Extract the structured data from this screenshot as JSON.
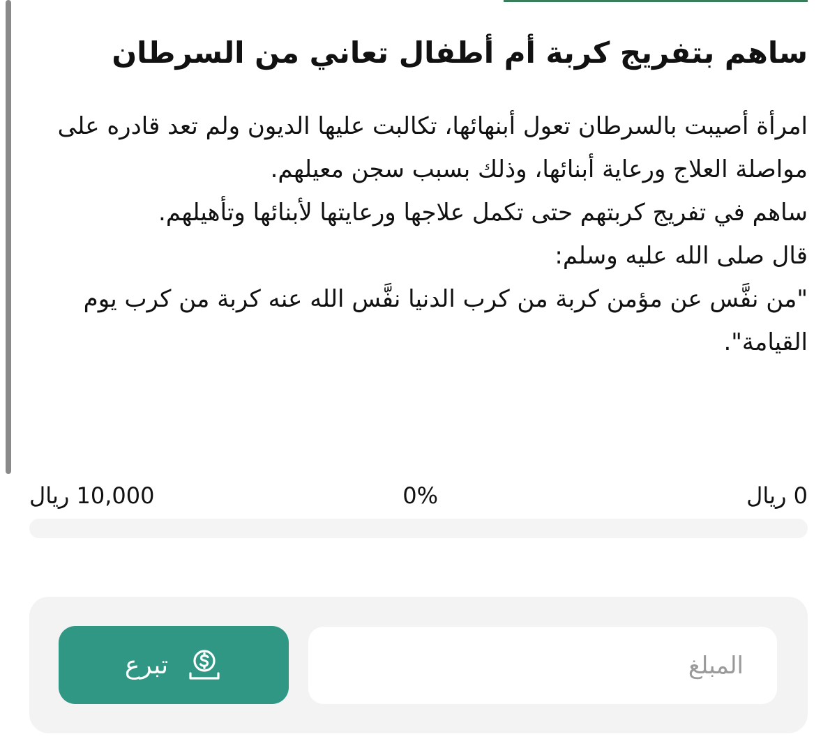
{
  "campaign": {
    "title": "ساهم بتفريج كربة أم أطفال تعاني من السرطان",
    "paragraphs": [
      "امرأة أصيبت بالسرطان تعول أبنهائها، تكالبت عليها الديون ولم تعد قادره على مواصلة العلاج ورعاية أبنائها، وذلك بسبب سجن معيلهم.",
      "ساهم في تفريج كربتهم حتى تكمل علاجها ورعايتها لأبنائها وتأهيلهم.",
      "قال صلى الله عليه وسلم:",
      "\"من نفَّس عن مؤمن كربة من كرب الدنيا نفَّس الله عنه كربة من كرب يوم القيامة\"."
    ]
  },
  "progress": {
    "min_label": "0 ريال",
    "percent_label": "0%",
    "max_label": "10,000 ريال",
    "fraction": 0,
    "fill_color": "#2f9784",
    "track_color": "#f4f4f4"
  },
  "donate": {
    "amount_placeholder": "المبلغ",
    "button_label": "تبرع",
    "button_icon": "money-hand-icon",
    "button_color": "#2f9784"
  }
}
